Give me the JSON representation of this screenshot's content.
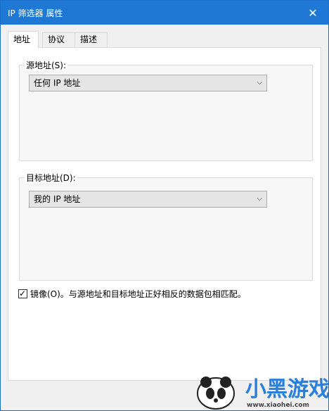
{
  "window": {
    "title": "IP 筛选器 属性",
    "close_glyph": "✕"
  },
  "tabs": [
    {
      "label": "地址",
      "active": true
    },
    {
      "label": "协议",
      "active": false
    },
    {
      "label": "描述",
      "active": false
    }
  ],
  "source": {
    "group_label": "源地址(S):",
    "selected": "任何 IP 地址"
  },
  "destination": {
    "group_label": "目标地址(D):",
    "selected": "我的 IP 地址"
  },
  "mirror": {
    "checked": true,
    "label": "镜像(O)。与源地址和目标地址正好相反的数据包相匹配。"
  },
  "watermark": {
    "brand": "小黑游戏",
    "url": "www.xiaohei.com"
  },
  "colors": {
    "titlebar": "#1f79d4",
    "panel": "#ffffff",
    "window": "#f0f0f0"
  }
}
